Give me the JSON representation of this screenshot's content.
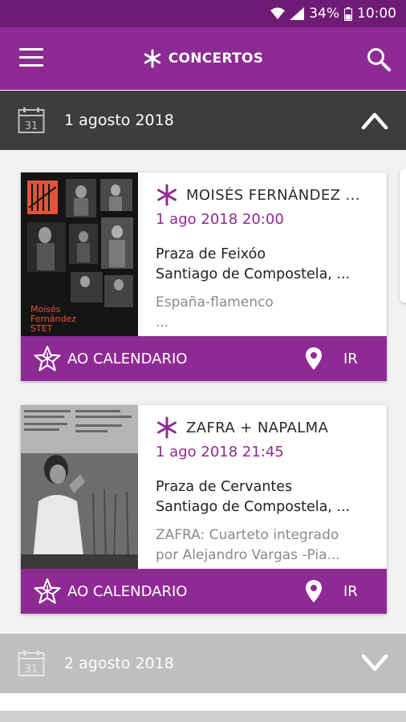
{
  "status_bar": {
    "battery": "34%",
    "time": "10:00"
  },
  "app_bar": {
    "title": "CONCERTOS"
  },
  "sections": [
    {
      "date_label": "1 agosto 2018",
      "expanded": true
    },
    {
      "date_label": "2 agosto 2018",
      "expanded": false
    }
  ],
  "events": [
    {
      "title": "MOISÉS FERNÁNDEZ ...",
      "datetime": "1 ago 2018 20:00",
      "venue_line1": "Praza de Feixóo",
      "venue_line2": "Santiago de Compostela, ...",
      "desc_line1": "España-flamenco",
      "desc_line2": "...",
      "poster_text_1": "Moisés",
      "poster_text_2": "Fernández",
      "poster_text_3": "STET",
      "calendar_label": "AO CALENDARIO",
      "go_label": "IR"
    },
    {
      "title": "ZAFRA + NAPALMA",
      "datetime": "1 ago 2018 21:45",
      "venue_line1": "Praza de Cervantes",
      "venue_line2": "Santiago de Compostela, ...",
      "desc_line1": "ZAFRA: Cuarteto integrado",
      "desc_line2": "por Alejandro Vargas -Pia...",
      "calendar_label": "AO CALENDARIO",
      "go_label": "IR"
    }
  ],
  "colors": {
    "primary": "#8e2a93",
    "status_bar": "#6f1a74",
    "date_bar_open": "#3d3d3d",
    "date_bar_closed": "#bfbfbf"
  }
}
